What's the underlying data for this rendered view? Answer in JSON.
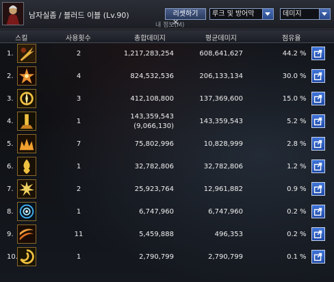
{
  "header": {
    "character_name": "남자실좀 / 블러드 이블 (Lv.90)",
    "reset_button": "리셋하기",
    "filter_select": "루크 및 방어막",
    "metric_select": "데미지",
    "background_caption": "내 정보(M)",
    "close_glyph": "✕"
  },
  "columns": {
    "skill": "스킬",
    "uses": "사용횟수",
    "total": "총합데미지",
    "avg": "평균데미지",
    "share": "점유율"
  },
  "rows": [
    {
      "rank": "1.",
      "uses": "2",
      "total": "1,217,283,254",
      "total_sub": "",
      "avg": "608,641,627",
      "share": "44.2",
      "pct": "%",
      "icon": "dark-slash-icon"
    },
    {
      "rank": "2.",
      "uses": "4",
      "total": "824,532,536",
      "total_sub": "",
      "avg": "206,133,134",
      "share": "30.0",
      "pct": "%",
      "icon": "blood-burst-icon"
    },
    {
      "rank": "3.",
      "uses": "3",
      "total": "412,108,800",
      "total_sub": "",
      "avg": "137,369,600",
      "share": "15.0",
      "pct": "%",
      "icon": "gold-aura-icon"
    },
    {
      "rank": "4.",
      "uses": "1",
      "total": "143,359,543",
      "total_sub": "(9,066,130)",
      "avg": "143,359,543",
      "share": "5.2",
      "pct": "%",
      "icon": "pillar-strike-icon"
    },
    {
      "rank": "5.",
      "uses": "7",
      "total": "75,802,996",
      "total_sub": "",
      "avg": "10,828,999",
      "share": "2.8",
      "pct": "%",
      "icon": "flame-crown-icon"
    },
    {
      "rank": "6.",
      "uses": "1",
      "total": "32,782,806",
      "total_sub": "",
      "avg": "32,782,806",
      "share": "1.2",
      "pct": "%",
      "icon": "flame-pillar-icon"
    },
    {
      "rank": "7.",
      "uses": "2",
      "total": "25,923,764",
      "total_sub": "",
      "avg": "12,961,882",
      "share": "0.9",
      "pct": "%",
      "icon": "explosion-icon"
    },
    {
      "rank": "8.",
      "uses": "1",
      "total": "6,747,960",
      "total_sub": "",
      "avg": "6,747,960",
      "share": "0.2",
      "pct": "%",
      "icon": "blue-vortex-icon"
    },
    {
      "rank": "9.",
      "uses": "11",
      "total": "5,459,888",
      "total_sub": "",
      "avg": "496,353",
      "share": "0.2",
      "pct": "%",
      "icon": "blade-wave-icon"
    },
    {
      "rank": "10.",
      "uses": "1",
      "total": "2,790,799",
      "total_sub": "",
      "avg": "2,790,799",
      "share": "0.1",
      "pct": "%",
      "icon": "golden-swirl-icon"
    }
  ],
  "colors": {
    "accent": "#2f5fc2",
    "frame": "#8aa0c8",
    "icon_border": "#8a6a2a"
  }
}
